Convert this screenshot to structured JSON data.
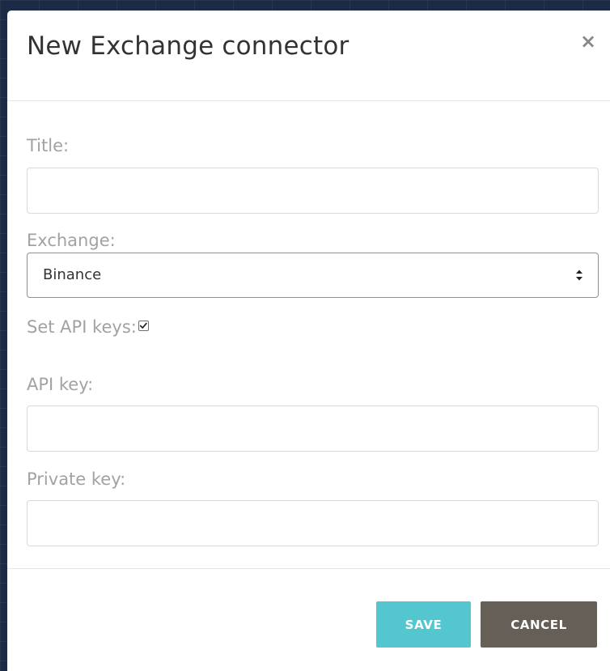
{
  "modal": {
    "title": "New Exchange connector",
    "close_symbol": "×"
  },
  "form": {
    "title_label": "Title:",
    "title_value": "",
    "exchange_label": "Exchange:",
    "exchange_selected": "Binance",
    "set_api_keys_label": "Set API keys:",
    "set_api_keys_checked": true,
    "api_key_label": "API key:",
    "api_key_value": "",
    "private_key_label": "Private key:",
    "private_key_value": ""
  },
  "footer": {
    "save_label": "SAVE",
    "cancel_label": "CANCEL"
  },
  "colors": {
    "save": "#53c6cf",
    "cancel": "#665f57",
    "label": "#a2a2a2",
    "title": "#333333"
  },
  "icons": {
    "close": "close-icon",
    "select": "select-arrows-icon",
    "checkbox": "checkmark-icon"
  }
}
